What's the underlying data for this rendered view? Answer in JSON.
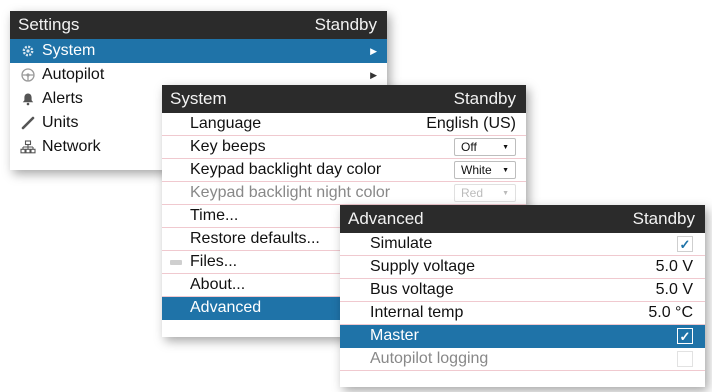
{
  "settings": {
    "title": "Settings",
    "status": "Standby",
    "items": [
      {
        "label": "System",
        "icon": "gear-icon",
        "submenu": true,
        "selected": true
      },
      {
        "label": "Autopilot",
        "icon": "helm-icon",
        "submenu": true
      },
      {
        "label": "Alerts",
        "icon": "bell-icon"
      },
      {
        "label": "Units",
        "icon": "ruler-icon"
      },
      {
        "label": "Network",
        "icon": "network-icon"
      }
    ]
  },
  "system": {
    "title": "System",
    "status": "Standby",
    "items": [
      {
        "label": "Language",
        "value": "English (US)"
      },
      {
        "label": "Key beeps",
        "dropdown": "Off"
      },
      {
        "label": "Keypad backlight day color",
        "dropdown": "White"
      },
      {
        "label": "Keypad backlight night color",
        "dropdown": "Red"
      },
      {
        "label": "Time..."
      },
      {
        "label": "Restore defaults..."
      },
      {
        "label": "Files..."
      },
      {
        "label": "About..."
      },
      {
        "label": "Advanced"
      }
    ]
  },
  "advanced": {
    "title": "Advanced",
    "status": "Standby",
    "items": [
      {
        "label": "Simulate",
        "checked": true
      },
      {
        "label": "Supply voltage",
        "value": "5.0 V"
      },
      {
        "label": "Bus voltage",
        "value": "5.0 V"
      },
      {
        "label": "Internal temp",
        "value": "5.0 °C"
      },
      {
        "label": "Master",
        "checked": true
      },
      {
        "label": "Autopilot logging",
        "checked": false
      }
    ]
  },
  "colors": {
    "titlebar": "#2b2b2b",
    "selection": "#1f73a8",
    "row_divider": "#f0c9cf"
  }
}
